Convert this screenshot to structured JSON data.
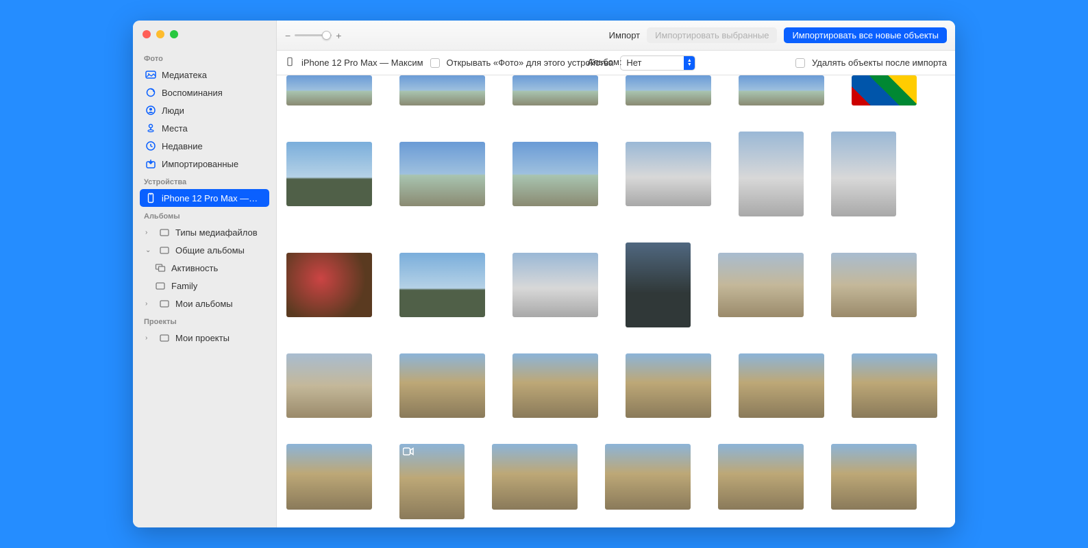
{
  "toolbar": {
    "title": "Импорт",
    "import_selected": "Импортировать выбранные",
    "import_all_new": "Импортировать все новые объекты"
  },
  "infobar": {
    "device": "iPhone 12 Pro Max — Максим",
    "open_photos": "Открывать «Фото» для этого устройства",
    "album_label": "Альбом:",
    "album_value": "Нет",
    "delete_after": "Удалять объекты после импорта"
  },
  "sidebar": {
    "sections": {
      "photo": "Фото",
      "devices": "Устройства",
      "albums": "Альбомы",
      "projects": "Проекты"
    },
    "items": {
      "library": "Медиатека",
      "memories": "Воспоминания",
      "people": "Люди",
      "places": "Места",
      "recent": "Недавние",
      "imported": "Импортированные",
      "device": "iPhone 12 Pro Max —…",
      "media_types": "Типы медиафайлов",
      "shared_albums": "Общие альбомы",
      "activity": "Активность",
      "family": "Family",
      "my_albums": "Мои альбомы",
      "my_projects": "Мои проекты"
    }
  }
}
